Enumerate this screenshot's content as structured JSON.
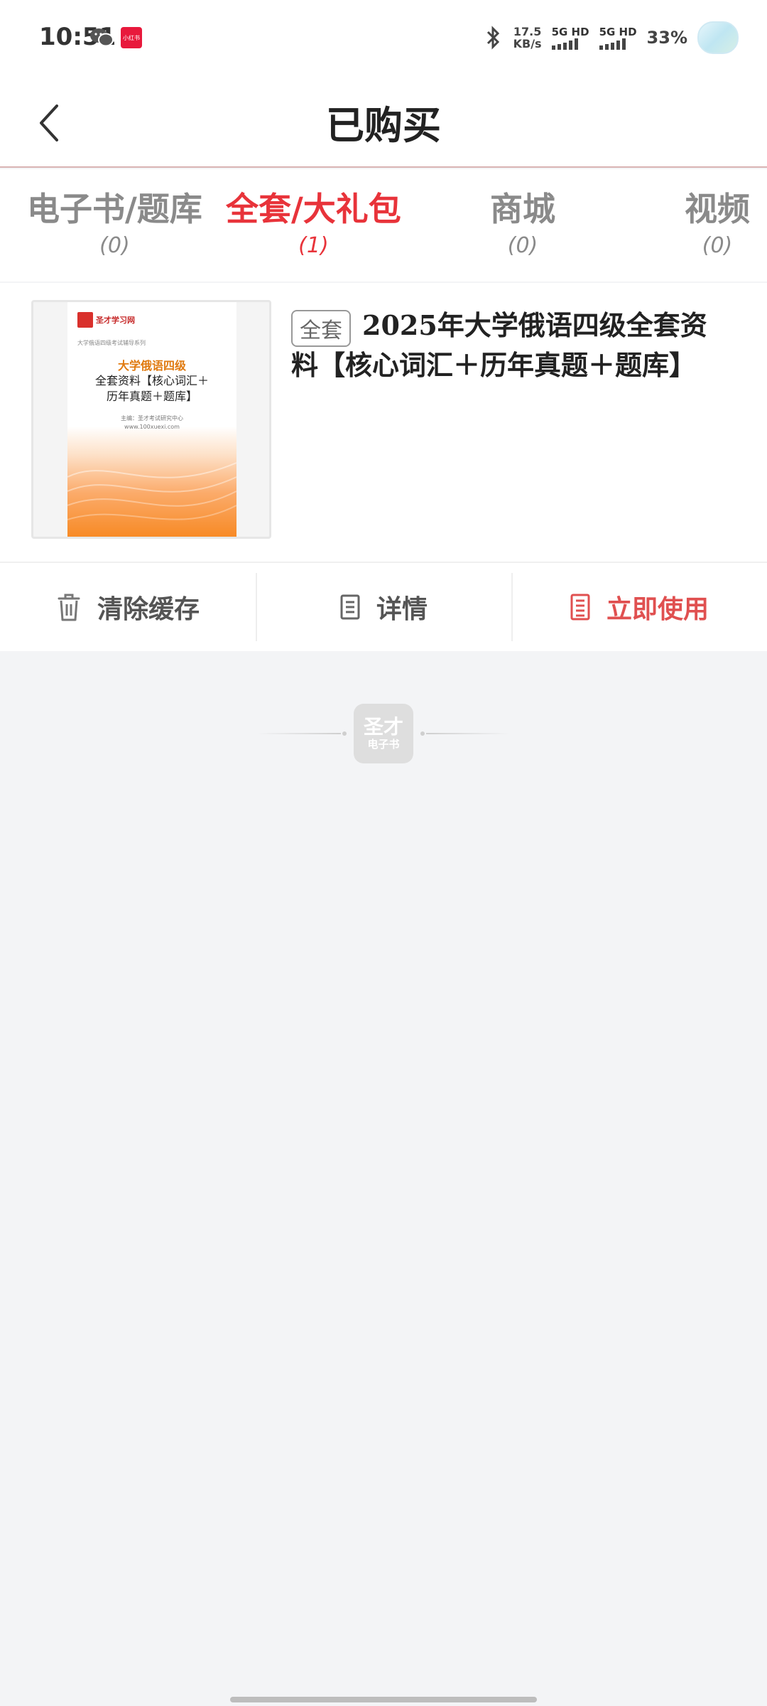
{
  "status_bar": {
    "time": "10:51",
    "app_badge": "小红书",
    "net_speed_value": "17.5",
    "net_speed_unit": "KB/s",
    "sim1_label": "5G HD",
    "sim2_label": "5G HD",
    "battery": "33%"
  },
  "header": {
    "title": "已购买"
  },
  "tabs": [
    {
      "label": "电子书/题库",
      "count": "(0)"
    },
    {
      "label": "全套/大礼包",
      "count": "(1)"
    },
    {
      "label": "商城",
      "count": "(0)"
    },
    {
      "label": "视频",
      "count": "(0)"
    }
  ],
  "product": {
    "badge": "全套",
    "title": "2025年大学俄语四级全套资料【核心词汇＋历年真题＋题库】",
    "cover": {
      "publisher": "圣才学习网",
      "series": "大学俄语四级考试辅导系列",
      "title_line1": "大学俄语四级",
      "title_line2": "全套资料【核心词汇＋",
      "title_line3": "历年真题＋题库】",
      "author_line1": "主编：圣才考试研究中心",
      "author_line2": "www.100xuexi.com"
    }
  },
  "actions": {
    "clear_cache": "清除缓存",
    "details": "详情",
    "use_now": "立即使用"
  },
  "watermark": {
    "line1": "圣才",
    "line2": "电子书"
  },
  "colors": {
    "accent": "#e8333a",
    "tab_inactive": "#8a8a8a",
    "background": "#f3f4f6"
  }
}
